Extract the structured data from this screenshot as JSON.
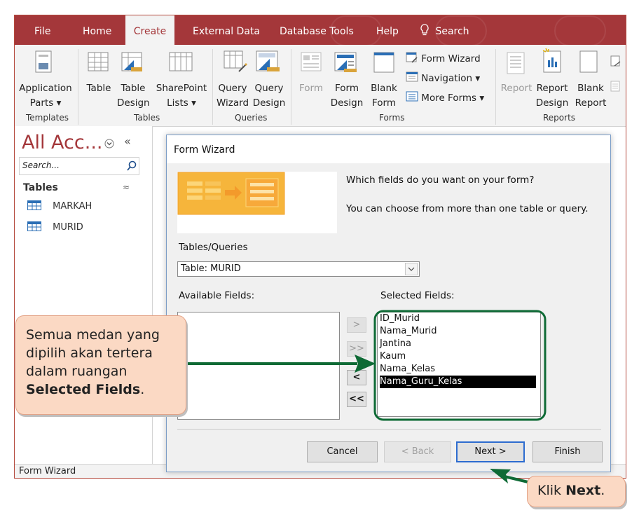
{
  "menu": {
    "file": "File",
    "home": "Home",
    "create": "Create",
    "external_data": "External Data",
    "database_tools": "Database Tools",
    "help": "Help",
    "search": "Search"
  },
  "ribbon": {
    "templates": {
      "application_parts_1": "Application",
      "application_parts_2": "Parts ▾",
      "group": "Templates"
    },
    "tables": {
      "table": "Table",
      "table_design_1": "Table",
      "table_design_2": "Design",
      "sharepoint_1": "SharePoint",
      "sharepoint_2": "Lists ▾",
      "group": "Tables"
    },
    "queries": {
      "wizard_1": "Query",
      "wizard_2": "Wizard",
      "design_1": "Query",
      "design_2": "Design",
      "group": "Queries"
    },
    "forms": {
      "form": "Form",
      "form_design_1": "Form",
      "form_design_2": "Design",
      "blank_1": "Blank",
      "blank_2": "Form",
      "form_wizard": "Form Wizard",
      "navigation": "Navigation ▾",
      "more_forms": "More Forms ▾",
      "group": "Forms"
    },
    "reports": {
      "report": "Report",
      "report_design_1": "Report",
      "report_design_2": "Design",
      "blank_1": "Blank",
      "blank_2": "Report",
      "group": "Reports"
    }
  },
  "nav": {
    "title": "All Acc...",
    "search_placeholder": "Search...",
    "section": "Tables",
    "items": [
      "MARKAH",
      "MURID"
    ]
  },
  "status": "Form Wizard",
  "dialog": {
    "title": "Form Wizard",
    "question": "Which fields do you want on your form?",
    "hint": "You can choose from more than one table or query.",
    "tables_label": "Tables/Queries",
    "table_value": "Table: MURID",
    "available_label": "Available Fields:",
    "selected_label": "Selected Fields:",
    "selected_fields": [
      "ID_Murid",
      "Nama_Murid",
      "Jantina",
      "Kaum",
      "Nama_Kelas",
      "Nama_Guru_Kelas"
    ],
    "move_one": ">",
    "move_all": ">>",
    "remove_one": "<",
    "remove_all": "<<",
    "cancel": "Cancel",
    "back": "< Back",
    "next": "Next >",
    "finish": "Finish"
  },
  "callouts": {
    "fields_line1": "Semua medan yang",
    "fields_line2": "dipilih akan tertera",
    "fields_line3": "dalam ruangan",
    "fields_bold": "Selected Fields",
    "fields_end": ".",
    "next_prefix": "Klik ",
    "next_bold": "Next",
    "next_end": "."
  },
  "colors": {
    "accent": "#a4373a",
    "callout_fill": "#fbd9c4",
    "arrow": "#0e6a35"
  }
}
